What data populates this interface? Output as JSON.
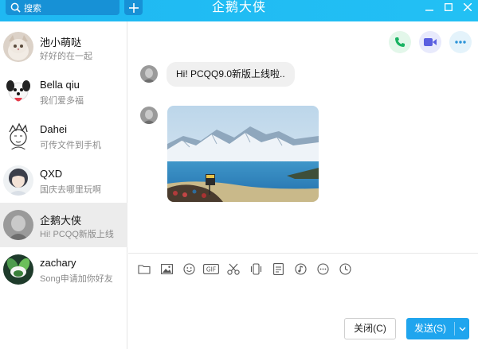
{
  "window": {
    "title": "企鹅大侠",
    "search_placeholder": "搜索",
    "add_label": "+"
  },
  "contacts": [
    {
      "name": "池小萌哒",
      "preview": "好好的在一起",
      "avatar": "cat-avatar"
    },
    {
      "name": "Bella qiu",
      "preview": "我们爱多福",
      "avatar": "dog-avatar"
    },
    {
      "name": "Dahei",
      "preview": "可传文件到手机",
      "avatar": "sketch-avatar"
    },
    {
      "name": "QXD",
      "preview": "国庆去哪里玩啊",
      "avatar": "girl-avatar"
    },
    {
      "name": "企鹅大侠",
      "preview": "Hi! PCQQ新版上线",
      "avatar": "gray-avatar"
    },
    {
      "name": "zachary",
      "preview": "Song申请加你好友",
      "avatar": "plant-avatar"
    }
  ],
  "chat": {
    "message_text": "Hi!  PCQQ9.0新版上线啦..",
    "image_desc": "lake-mountain-photo"
  },
  "toolbar_icons": [
    "folder-icon",
    "image-icon",
    "emoji-icon",
    "gif-icon",
    "scissors-icon",
    "shake-icon",
    "doc-icon",
    "music-icon",
    "more-icon",
    "clock-icon"
  ],
  "buttons": {
    "close_label": "关闭(C)",
    "send_label": "发送(S)"
  },
  "colors": {
    "titlebar": "#22c0f4",
    "send": "#1fa5ee",
    "phone": "#19b262",
    "video": "#5a5fe0",
    "more": "#2c94d8"
  }
}
